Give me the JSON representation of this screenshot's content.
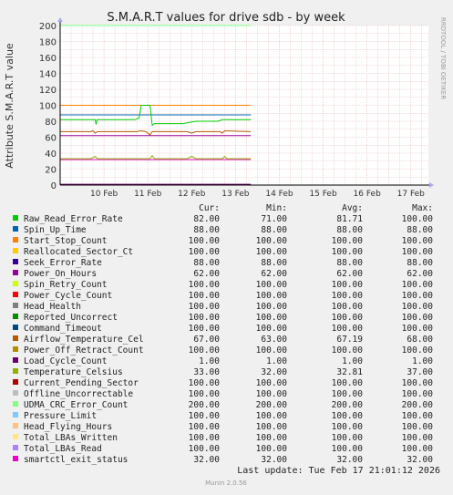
{
  "chart_data": {
    "type": "line",
    "title": "S.M.A.R.T values for drive sdb - by week",
    "ylabel": "Attribute S.M.A.R.T value",
    "side_label": "RRDTOOL / TOBI OETIKER",
    "ylim": [
      0,
      200
    ],
    "yticks": [
      0,
      20,
      40,
      60,
      80,
      100,
      120,
      140,
      160,
      180,
      200
    ],
    "x_start": "9 Feb 2026",
    "xlim_days": [
      0,
      8.4
    ],
    "data_end_day": 4.35,
    "xticks": [
      {
        "label": "10 Feb",
        "day": 1
      },
      {
        "label": "11 Feb",
        "day": 2
      },
      {
        "label": "12 Feb",
        "day": 3
      },
      {
        "label": "13 Feb",
        "day": 4
      },
      {
        "label": "14 Feb",
        "day": 5
      },
      {
        "label": "15 Feb",
        "day": 6
      },
      {
        "label": "16 Feb",
        "day": 7
      },
      {
        "label": "17 Feb",
        "day": 8
      }
    ],
    "grid": true,
    "legend_columns": [
      "Cur:",
      "Min:",
      "Avg:",
      "Max:"
    ],
    "series": [
      {
        "name": "Raw_Read_Error_Rate",
        "color": "#00cc00",
        "cur": "82.00",
        "min": "71.00",
        "avg": "81.71",
        "max": "100.00",
        "base": 82,
        "points": [
          [
            0,
            82
          ],
          [
            0.8,
            82
          ],
          [
            0.82,
            76
          ],
          [
            0.84,
            82
          ],
          [
            1.7,
            82
          ],
          [
            1.8,
            84
          ],
          [
            1.85,
            100
          ],
          [
            2.05,
            100
          ],
          [
            2.1,
            75
          ],
          [
            2.15,
            77
          ],
          [
            2.8,
            77
          ],
          [
            3.1,
            80
          ],
          [
            3.6,
            80
          ],
          [
            3.7,
            82
          ],
          [
            4.35,
            82
          ]
        ]
      },
      {
        "name": "Spin_Up_Time",
        "color": "#0066b3",
        "cur": "88.00",
        "min": "88.00",
        "avg": "88.00",
        "max": "88.00",
        "base": 88
      },
      {
        "name": "Start_Stop_Count",
        "color": "#ff8000",
        "cur": "100.00",
        "min": "100.00",
        "avg": "100.00",
        "max": "100.00",
        "base": 100
      },
      {
        "name": "Reallocated_Sector_Ct",
        "color": "#ffcc00",
        "cur": "100.00",
        "min": "100.00",
        "avg": "100.00",
        "max": "100.00",
        "base": 100
      },
      {
        "name": "Seek_Error_Rate",
        "color": "#330099",
        "cur": "88.00",
        "min": "88.00",
        "avg": "88.00",
        "max": "88.00",
        "base": 88
      },
      {
        "name": "Power_On_Hours",
        "color": "#990099",
        "cur": "62.00",
        "min": "62.00",
        "avg": "62.00",
        "max": "62.00",
        "base": 62
      },
      {
        "name": "Spin_Retry_Count",
        "color": "#ccff00",
        "cur": "100.00",
        "min": "100.00",
        "avg": "100.00",
        "max": "100.00",
        "base": 100
      },
      {
        "name": "Power_Cycle_Count",
        "color": "#ff0000",
        "cur": "100.00",
        "min": "100.00",
        "avg": "100.00",
        "max": "100.00",
        "base": 100
      },
      {
        "name": "Head_Health",
        "color": "#808080",
        "cur": "100.00",
        "min": "100.00",
        "avg": "100.00",
        "max": "100.00",
        "base": 100
      },
      {
        "name": "Reported_Uncorrect",
        "color": "#008f00",
        "cur": "100.00",
        "min": "100.00",
        "avg": "100.00",
        "max": "100.00",
        "base": 100
      },
      {
        "name": "Command_Timeout",
        "color": "#00487d",
        "cur": "100.00",
        "min": "100.00",
        "avg": "100.00",
        "max": "100.00",
        "base": 100
      },
      {
        "name": "Airflow_Temperature_Cel",
        "color": "#b35a00",
        "cur": "67.00",
        "min": "63.00",
        "avg": "67.19",
        "max": "68.00",
        "base": 67,
        "points": [
          [
            0,
            67
          ],
          [
            0.7,
            67
          ],
          [
            0.75,
            68
          ],
          [
            0.8,
            65
          ],
          [
            0.85,
            67
          ],
          [
            1.75,
            67
          ],
          [
            1.85,
            68
          ],
          [
            1.95,
            67
          ],
          [
            2.05,
            63
          ],
          [
            2.1,
            67
          ],
          [
            2.9,
            67
          ],
          [
            3.0,
            65
          ],
          [
            3.1,
            67
          ],
          [
            3.65,
            67
          ],
          [
            3.7,
            65
          ],
          [
            3.75,
            68
          ],
          [
            4.35,
            67
          ]
        ]
      },
      {
        "name": "Power_Off_Retract_Count",
        "color": "#b38f00",
        "cur": "100.00",
        "min": "100.00",
        "avg": "100.00",
        "max": "100.00",
        "base": 100
      },
      {
        "name": "Load_Cycle_Count",
        "color": "#6b006b",
        "cur": "1.00",
        "min": "1.00",
        "avg": "1.00",
        "max": "1.00",
        "base": 1
      },
      {
        "name": "Temperature_Celsius",
        "color": "#8fb300",
        "cur": "33.00",
        "min": "32.00",
        "avg": "32.81",
        "max": "37.00",
        "base": 33,
        "points": [
          [
            0,
            33
          ],
          [
            0.7,
            33
          ],
          [
            0.8,
            36
          ],
          [
            0.85,
            33
          ],
          [
            2.05,
            33
          ],
          [
            2.1,
            37
          ],
          [
            2.15,
            33
          ],
          [
            2.9,
            33
          ],
          [
            3.0,
            36
          ],
          [
            3.1,
            33
          ],
          [
            3.7,
            33
          ],
          [
            3.75,
            36
          ],
          [
            3.8,
            33
          ],
          [
            4.35,
            33
          ]
        ]
      },
      {
        "name": "Current_Pending_Sector",
        "color": "#b30000",
        "cur": "100.00",
        "min": "100.00",
        "avg": "100.00",
        "max": "100.00",
        "base": 100
      },
      {
        "name": "Offline_Uncorrectable",
        "color": "#bebebe",
        "cur": "100.00",
        "min": "100.00",
        "avg": "100.00",
        "max": "100.00",
        "base": 100
      },
      {
        "name": "UDMA_CRC_Error_Count",
        "color": "#80ff80",
        "cur": "200.00",
        "min": "200.00",
        "avg": "200.00",
        "max": "200.00",
        "base": 200
      },
      {
        "name": "Pressure_Limit",
        "color": "#80c9ff",
        "cur": "100.00",
        "min": "100.00",
        "avg": "100.00",
        "max": "100.00",
        "base": 100
      },
      {
        "name": "Head_Flying_Hours",
        "color": "#ffc080",
        "cur": "100.00",
        "min": "100.00",
        "avg": "100.00",
        "max": "100.00",
        "base": 100
      },
      {
        "name": "Total_LBAs_Written",
        "color": "#ffe680",
        "cur": "100.00",
        "min": "100.00",
        "avg": "100.00",
        "max": "100.00",
        "base": 100
      },
      {
        "name": "Total_LBAs_Read",
        "color": "#aa80ff",
        "cur": "100.00",
        "min": "100.00",
        "avg": "100.00",
        "max": "100.00",
        "base": 100
      },
      {
        "name": "smartctl_exit_status",
        "color": "#ee00cc",
        "cur": "32.00",
        "min": "32.00",
        "avg": "32.00",
        "max": "32.00",
        "base": 32
      }
    ],
    "last_update": "Last update: Tue Feb 17 21:01:12 2026",
    "footer": "Munin 2.0.56"
  }
}
